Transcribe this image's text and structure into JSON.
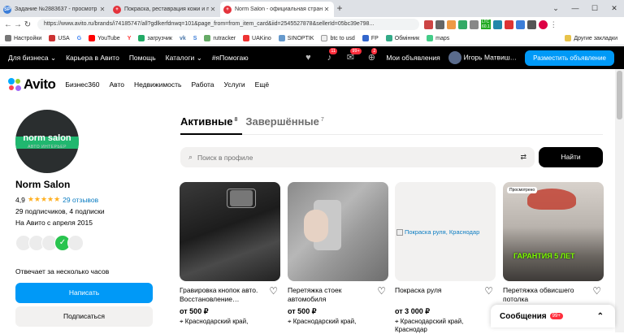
{
  "browser": {
    "tabs": [
      {
        "label": "Задание №2883637 - просмотр за",
        "favicon": "SP",
        "color": "#3b7dd8"
      },
      {
        "label": "Покраска, реставрация кожи и п",
        "favicon": "",
        "color": "#e4333c"
      },
      {
        "label": "Norm Salon - официальная стран",
        "favicon": "",
        "color": "#e4333c"
      }
    ],
    "new_tab": "+",
    "url": "https://www.avito.ru/brands/i74185747/all?gdlkerfdnwq=101&page_from=from_item_card&iid=2545527878&sellerId=05bc39e798...",
    "bookmarks": [
      "Настройки",
      "USA",
      "G",
      "YouTube",
      "Y",
      "загрузчик",
      "vk",
      "S",
      "rutracker",
      "UAKino",
      "SINOPTIK",
      "btc to usd",
      "FP",
      "Обмінник",
      "maps"
    ],
    "other_bookmarks": "Другие закладки",
    "ext_badge_ltc": "LTC",
    "ext_badge_val": "60.1"
  },
  "topnav": {
    "items": [
      "Для бизнеса",
      "Карьера в Авито",
      "Помощь",
      "Каталоги",
      "#яПомогаю"
    ],
    "badge_notifications": "11",
    "badge_messages": "99+",
    "badge_cart": "2",
    "my_ads": "Мои объявления",
    "user": "Игорь Матвиш…",
    "post_button": "Разместить объявление"
  },
  "sitenav": {
    "logo": "Avito",
    "items": [
      "Бизнес360",
      "Авто",
      "Недвижимость",
      "Работа",
      "Услуги",
      "Ещё"
    ]
  },
  "profile": {
    "avatar_line1": "norm salon",
    "avatar_line2": "АВТО ИНТЕРЬЕР",
    "name": "Norm Salon",
    "rating": "4,9",
    "stars": "★★★★★",
    "reviews": "29 отзывов",
    "followers": "29 подписчиков, 4 подписки",
    "since": "На Авито с апреля 2015",
    "response": "Отвечает за несколько часов",
    "write_button": "Написать",
    "subscribe_button": "Подписаться"
  },
  "tabs": {
    "active": "Активные",
    "active_count": "8",
    "done": "Завершённые",
    "done_count": "7"
  },
  "search": {
    "placeholder": "Поиск в профиле",
    "button": "Найти"
  },
  "cards": [
    {
      "title": "Гравировка кнопок авто. Восстановление…",
      "price": "от 500 ₽",
      "location": "Краснодарский край,"
    },
    {
      "title": "Перетяжка стоек автомобиля",
      "price": "от 500 ₽",
      "location": "Краснодарский край,"
    },
    {
      "title": "Покраска руля",
      "price": "от 3 000 ₽",
      "location": "Краснодарский край, Краснодар",
      "alt": "Покраска руля, Краснодар"
    },
    {
      "title": "Перетяжка обвисшего потолка",
      "price": "",
      "location": "",
      "seen": "Просмотрено",
      "overlay": "ГАРАНТИЯ 5 ЛЕТ"
    }
  ],
  "chats": {
    "label": "Сообщения",
    "badge": "99+"
  },
  "icons": {
    "heart": "♡",
    "pin": "⌖",
    "chevron_up": "⌃"
  }
}
